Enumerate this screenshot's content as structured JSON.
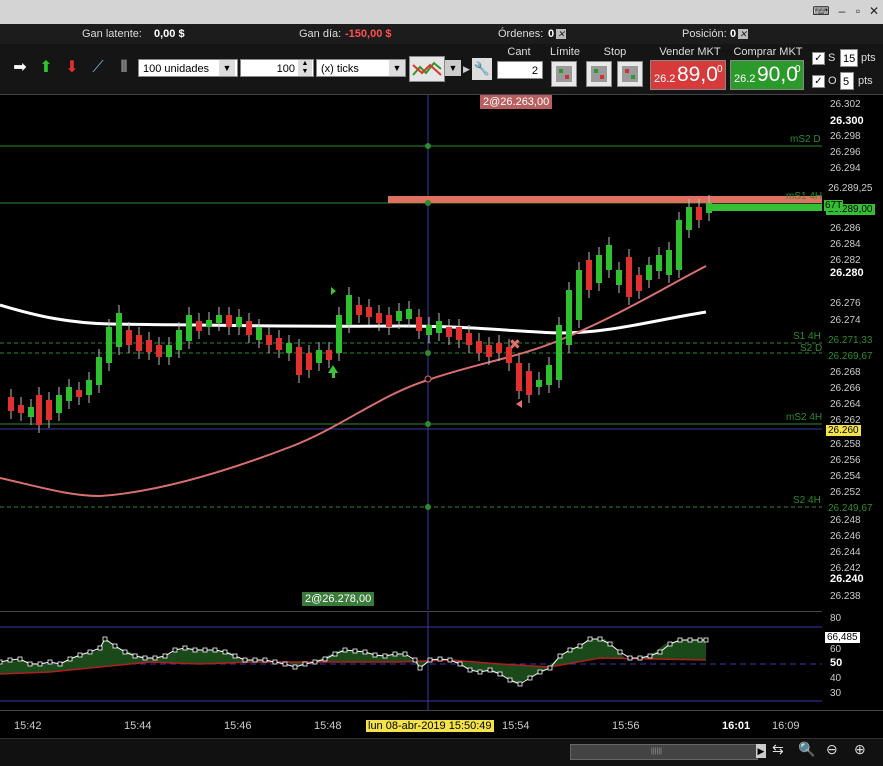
{
  "account": {
    "gan_latente_label": "Gan latente:",
    "gan_latente_value": "0,00 $",
    "gan_dia_label": "Gan día:",
    "gan_dia_value": "-150,00 $",
    "ordenes_label": "Órdenes:",
    "ordenes_value": "0",
    "posicion_label": "Posición:",
    "posicion_value": "0"
  },
  "toolbar": {
    "units_select": "100 unidades",
    "qty_value": "100",
    "mode_select": "(x) ticks",
    "cant_label": "Cant",
    "cant_value": "2",
    "limite_label": "Límite",
    "stop_label": "Stop",
    "sell_label": "Vender MKT",
    "sell_prefix": "26.2",
    "sell_big": "89,0",
    "sell_sup": "0",
    "buy_label": "Comprar MKT",
    "buy_prefix": "26.2",
    "buy_big": "90,0",
    "buy_sup": "0",
    "s_label": "S",
    "s_value": "15",
    "s_unit": "pts",
    "o_label": "O",
    "o_value": "5",
    "o_unit": "pts",
    "colors": {
      "sell": "#d63a3a",
      "buy": "#2a9a2a"
    }
  },
  "chart": {
    "top_tag": "2@26.263,00",
    "bottom_tag": "2@26.278,00",
    "line_labels": {
      "ms2d": "mS2 D",
      "ms1_4h": "mS1 4H",
      "s1_4h": "S1 4H",
      "s2d": "S2 D",
      "ms2_4h": "mS2 4H",
      "s2_4h": "S2 4H"
    },
    "y_ticks": [
      "26.302",
      "26.300",
      "26.298",
      "26.296",
      "26.294",
      "26.289,25",
      "26.289,00",
      "26.286",
      "26.284",
      "26.282",
      "26.280",
      "26.278",
      "26.276",
      "26.274",
      "26.271,33",
      "26.269,67",
      "26.268",
      "26.266",
      "26.264",
      "26.262",
      "26.260",
      "26.258",
      "26.256",
      "26.254",
      "26.252",
      "26.249,67",
      "26.248",
      "26.246",
      "26.244",
      "26.242",
      "26.240",
      "26.238"
    ],
    "price_tag_67": "67T",
    "osc_ticks": [
      "80",
      "66,485",
      "60",
      "50",
      "40",
      "30"
    ],
    "x_ticks": [
      "15:42",
      "15:44",
      "15:46",
      "15:48",
      "15:54",
      "15:56",
      "16:01",
      "16:09"
    ],
    "crosshair_date": "lun 08-abr-2019 15:50:49"
  }
}
